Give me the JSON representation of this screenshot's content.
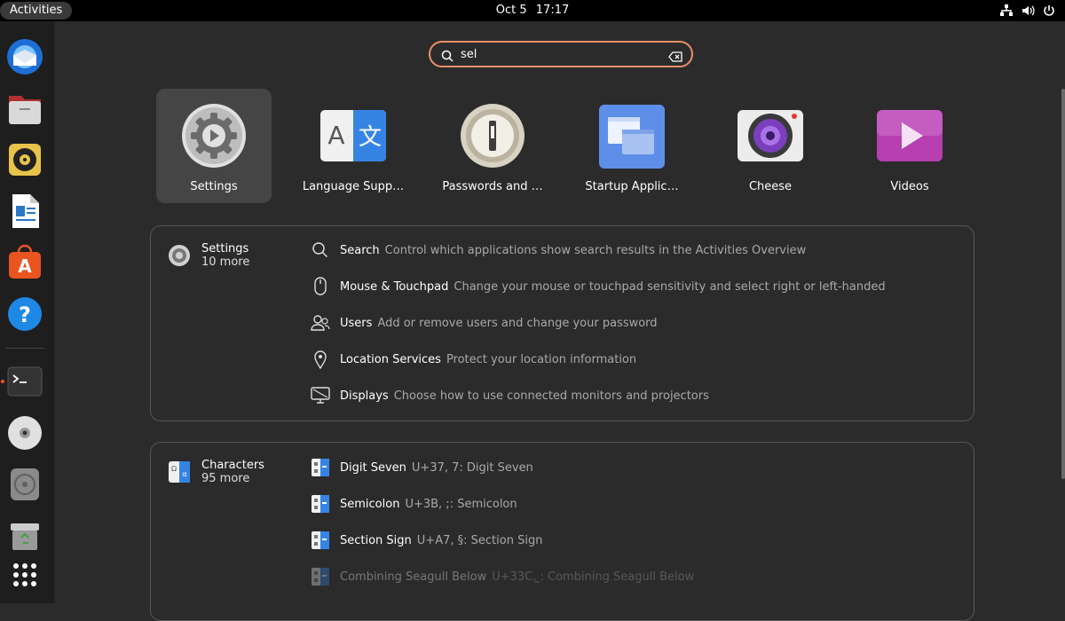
{
  "topbar": {
    "activities": "Activities",
    "date": "Oct 5",
    "time": "17:17"
  },
  "search": {
    "query": "sel"
  },
  "apps": [
    {
      "label": "Settings",
      "icon": "settings-icon"
    },
    {
      "label": "Language Supp…",
      "icon": "language-support-icon"
    },
    {
      "label": "Passwords and …",
      "icon": "passwords-icon"
    },
    {
      "label": "Startup Applic…",
      "icon": "startup-applications-icon"
    },
    {
      "label": "Cheese",
      "icon": "cheese-icon"
    },
    {
      "label": "Videos",
      "icon": "videos-icon"
    }
  ],
  "dock": [
    "thunderbird-icon",
    "files-icon",
    "rhythmbox-icon",
    "libreoffice-writer-icon",
    "software-icon",
    "help-icon",
    "terminal-icon",
    "disc-icon",
    "disc-drive-icon",
    "trash-icon",
    "show-apps-icon"
  ],
  "settings_panel": {
    "provider": "Settings",
    "more": "10 more",
    "rows": [
      {
        "title": "Search",
        "desc": "Control which applications show search results in the Activities Overview",
        "icon": "search-icon"
      },
      {
        "title": "Mouse & Touchpad",
        "desc": "Change your mouse or touchpad sensitivity and select right or left-handed",
        "icon": "mouse-icon"
      },
      {
        "title": "Users",
        "desc": "Add or remove users and change your password",
        "icon": "users-icon"
      },
      {
        "title": "Location Services",
        "desc": "Protect your location information",
        "icon": "location-icon"
      },
      {
        "title": "Displays",
        "desc": "Choose how to use connected monitors and projectors",
        "icon": "display-icon"
      }
    ]
  },
  "characters_panel": {
    "provider": "Characters",
    "more": "95 more",
    "rows": [
      {
        "title": "Digit Seven",
        "desc": "U+37, 7: Digit Seven"
      },
      {
        "title": "Semicolon",
        "desc": "U+3B, ;: Semicolon"
      },
      {
        "title": "Section Sign",
        "desc": "U+A7, §: Section Sign"
      },
      {
        "title": "Combining Seagull Below",
        "desc": "U+33C, ̼: Combining Seagull Below"
      }
    ]
  },
  "colors": {
    "accent": "#e95420",
    "search_border": "#e8916a",
    "background": "#2b2b2b"
  }
}
